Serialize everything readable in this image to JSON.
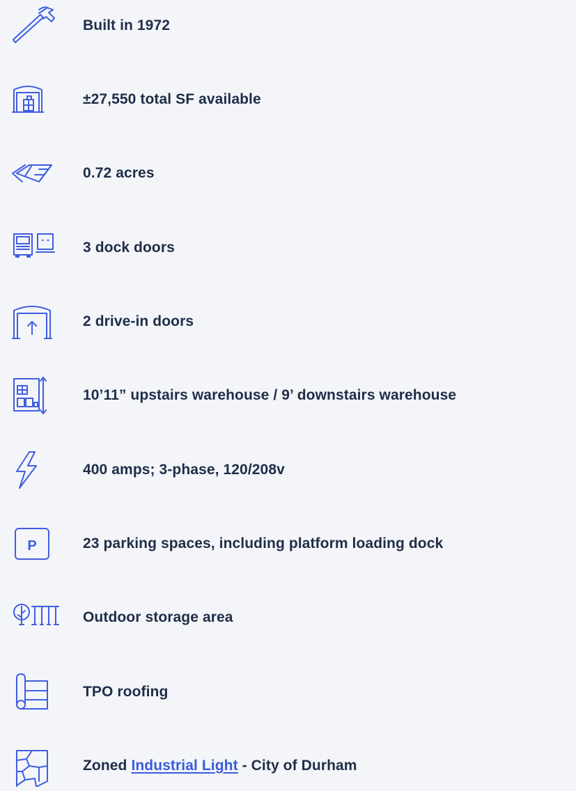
{
  "features": [
    {
      "icon": "hammer-icon",
      "label": "Built in 1972"
    },
    {
      "icon": "warehouse-boxes-icon",
      "label": "±27,550 total SF available"
    },
    {
      "icon": "land-parcel-icon",
      "label": "0.72 acres"
    },
    {
      "icon": "truck-dock-icon",
      "label": "3 dock doors"
    },
    {
      "icon": "drive-in-door-icon",
      "label": "2 drive-in doors"
    },
    {
      "icon": "ceiling-height-icon",
      "label": "10’11” upstairs warehouse / 9’ downstairs warehouse"
    },
    {
      "icon": "lightning-icon",
      "label": "400 amps; 3-phase, 120/208v"
    },
    {
      "icon": "parking-icon",
      "label": "23 parking spaces, including platform loading dock",
      "icon_text": "P"
    },
    {
      "icon": "outdoor-storage-icon",
      "label": "Outdoor storage area"
    },
    {
      "icon": "roof-icon",
      "label": "TPO roofing"
    },
    {
      "icon": "zoning-map-icon",
      "label_prefix": "Zoned ",
      "link_text": "Industrial Light",
      "label_suffix": " - City of Durham"
    }
  ],
  "colors": {
    "background": "#f3f5f9",
    "text": "#1f2d47",
    "icon": "#3f5ee0",
    "link": "#3a5bd9"
  }
}
